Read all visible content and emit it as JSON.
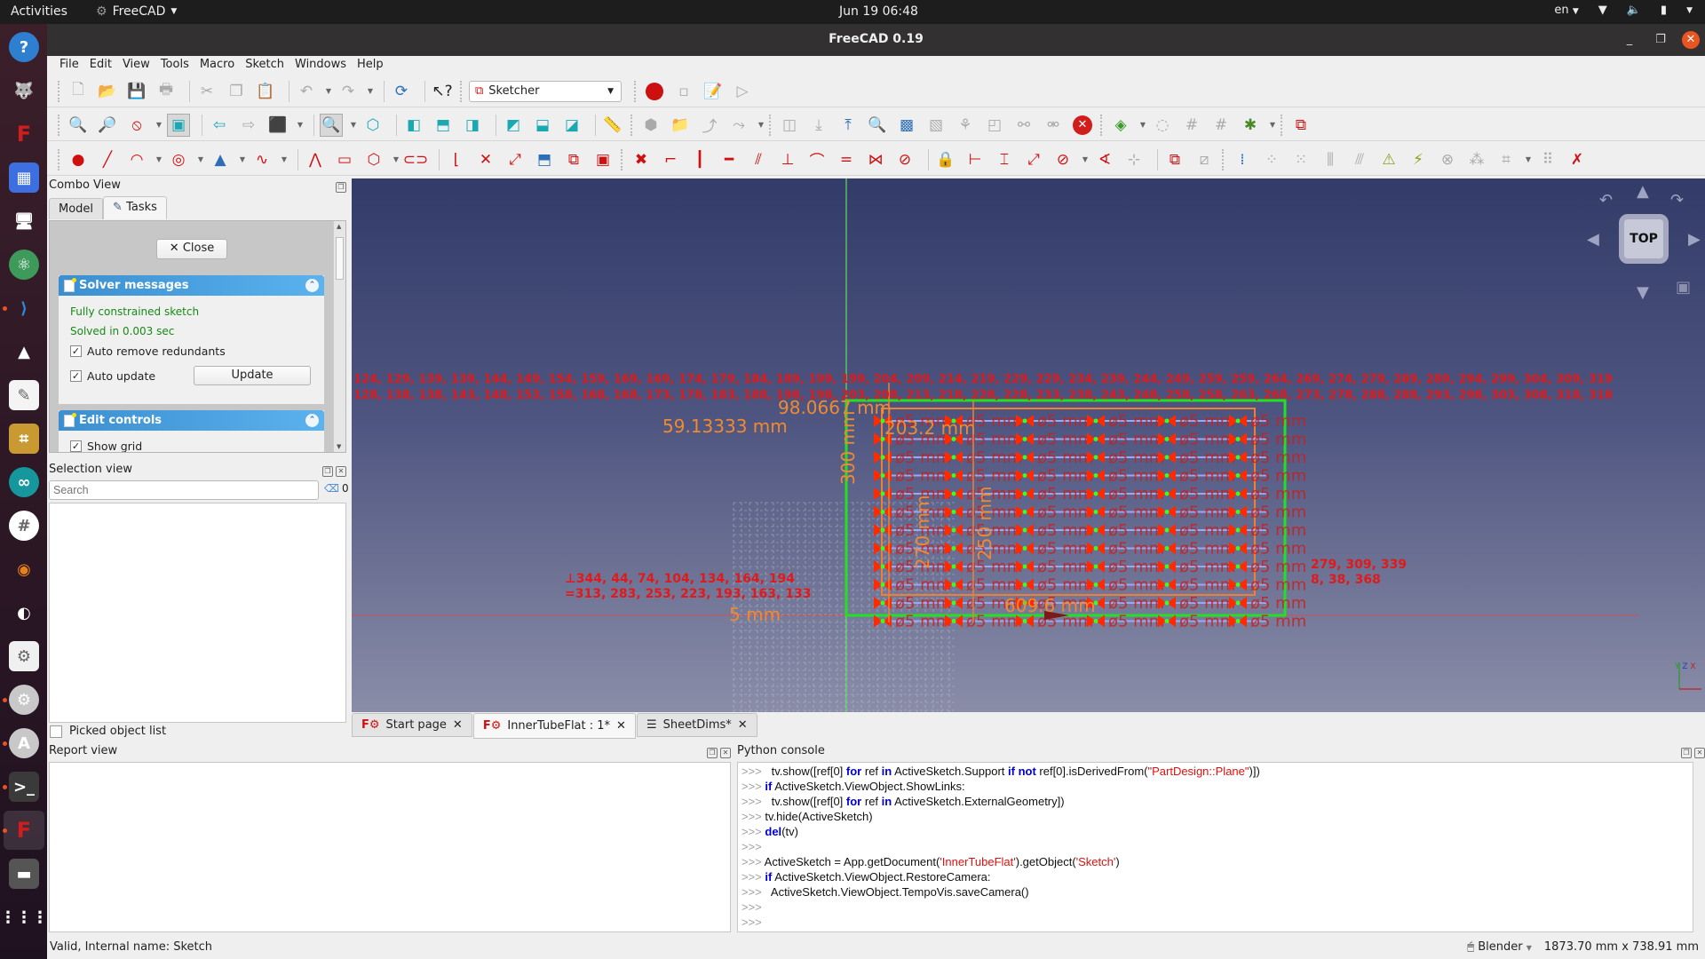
{
  "topbar": {
    "activities": "Activities",
    "app_menu": "FreeCAD",
    "clock": "Jun 19  06:48",
    "language": "en",
    "icons": [
      "wifi-icon",
      "volume-icon",
      "battery-icon",
      "system-menu-icon"
    ]
  },
  "dock": {
    "apps": [
      {
        "name": "help",
        "glyph": "?",
        "bg": "#2f7fd0",
        "running": false
      },
      {
        "name": "gimp",
        "glyph": "🐺",
        "bg": "transparent",
        "running": false
      },
      {
        "name": "freecad",
        "glyph": "F",
        "bg": "transparent",
        "running": false
      },
      {
        "name": "screenshot",
        "glyph": "▦",
        "bg": "#3d6fe0",
        "running": false
      },
      {
        "name": "display-settings",
        "glyph": "🖥",
        "bg": "transparent",
        "running": false
      },
      {
        "name": "atom",
        "glyph": "⚛",
        "bg": "#3d9a5a",
        "running": false
      },
      {
        "name": "vscode",
        "glyph": "⟩",
        "bg": "transparent",
        "running": true
      },
      {
        "name": "inkscape",
        "glyph": "▲",
        "bg": "transparent",
        "running": false
      },
      {
        "name": "text-editor",
        "glyph": "✎",
        "bg": "#f4f4f4",
        "running": false
      },
      {
        "name": "fritzing",
        "glyph": "⌗",
        "bg": "#c99a32",
        "running": false
      },
      {
        "name": "arduino",
        "glyph": "∞",
        "bg": "#16979e",
        "running": false
      },
      {
        "name": "slack",
        "glyph": "#",
        "bg": "#ffffff",
        "running": false
      },
      {
        "name": "blender",
        "glyph": "◉",
        "bg": "transparent",
        "running": false
      },
      {
        "name": "simplescreenrecorder",
        "glyph": "◐",
        "bg": "transparent",
        "running": false
      },
      {
        "name": "settings-alt",
        "glyph": "⚙",
        "bg": "#f0f0f0",
        "running": false
      },
      {
        "name": "system-settings",
        "glyph": "⚙",
        "bg": "#c8c8c8",
        "running": true
      },
      {
        "name": "software-updater",
        "glyph": "A",
        "bg": "#c8c8c8",
        "running": true
      },
      {
        "name": "terminal",
        "glyph": ">_",
        "bg": "#3a3a3a",
        "running": true
      },
      {
        "name": "freecad-active",
        "glyph": "F",
        "bg": "transparent",
        "running": true
      },
      {
        "name": "trash",
        "glyph": "▬",
        "bg": "#555",
        "running": false
      },
      {
        "name": "show-applications",
        "glyph": "⋮⋮⋮",
        "bg": "transparent",
        "running": false
      }
    ]
  },
  "window": {
    "title": "FreeCAD 0.19",
    "minimize": "_",
    "maximize": "❐",
    "close": "✕"
  },
  "menubar": [
    "File",
    "Edit",
    "View",
    "Tools",
    "Macro",
    "Sketch",
    "Windows",
    "Help"
  ],
  "toolbar": {
    "workbench": "Sketcher",
    "file_tools": [
      "new-document-icon",
      "open-icon",
      "save-icon",
      "print-icon",
      "cut-icon",
      "copy-icon",
      "paste-icon",
      "undo-icon",
      "redo-icon",
      "refresh-icon",
      "whats-this-icon"
    ],
    "macro_tools": [
      "record-macro-icon",
      "stop-macro-icon",
      "edit-macro-icon",
      "run-macro-icon"
    ]
  },
  "combo_view": {
    "title": "Combo View",
    "tabs": [
      "Model",
      "Tasks"
    ],
    "active_tab": "Tasks",
    "close_button": "Close",
    "solver_section": {
      "title": "Solver messages",
      "status": "Fully constrained sketch",
      "solve_time": "Solved in 0.003 sec",
      "auto_remove_redundants": {
        "label": "Auto remove redundants",
        "checked": true
      },
      "auto_update": {
        "label": "Auto update",
        "checked": true
      },
      "update_button": "Update"
    },
    "edit_controls": {
      "title": "Edit controls",
      "show_grid": {
        "label": "Show grid",
        "checked": true
      }
    }
  },
  "selection_view": {
    "title": "Selection view",
    "search_placeholder": "Search",
    "count": "0",
    "picked_object_list": {
      "label": "Picked object list",
      "checked": false
    }
  },
  "viewport": {
    "navcube_face": "TOP",
    "constraint_row1": "124, 129, 139, 139, 144, 149, 154, 159, 169, 169, 174, 179, 184, 189, 199, 199, 204, 209, 214, 219, 229, 229, 234, 239, 244, 249, 259, 259, 264, 269, 274, 279, 289, 289, 294, 299, 304, 309, 319",
    "constraint_row2": "128, 138, 138, 143, 148, 153, 158, 168, 168, 173, 178, 183, 188, 198, 198, 203, 208, 213, 218, 228, 228, 233, 238, 243, 248, 258, 258, 263, 268, 273, 278, 288, 288, 293, 298, 303, 308, 318, 318",
    "left_list1": "344, 44, 74, 104, 134, 164, 194",
    "left_list2": "313, 283, 253, 223, 193, 163, 133",
    "right_list1": "279, 309, 339",
    "right_list2": "8, 38, 368",
    "hole_label": "ø5 mm",
    "dim_labels": [
      "203.2 mm",
      "300 mm",
      "270 mm",
      "250 mm",
      "609.6 mm",
      "5 mm",
      "59.13333 mm",
      "98.0667 mm"
    ],
    "axis_labels": {
      "x": "X",
      "y": "Y",
      "z": "Z"
    }
  },
  "doc_tabs": [
    {
      "label": "Start page",
      "icon": "freecad-icon",
      "active": false
    },
    {
      "label": "InnerTubeFlat : 1*",
      "icon": "freecad-icon",
      "active": true
    },
    {
      "label": "SheetDims*",
      "icon": "spreadsheet-icon",
      "active": false
    }
  ],
  "report_view": {
    "title": "Report view"
  },
  "python_console": {
    "title": "Python console",
    "lines": [
      [
        {
          "t": ">>> ",
          "c": "pr"
        },
        {
          "t": "  tv.show([ref[0] ",
          "c": ""
        },
        {
          "t": "for",
          "c": "kw"
        },
        {
          "t": " ref ",
          "c": ""
        },
        {
          "t": "in",
          "c": "kw"
        },
        {
          "t": " ActiveSketch.Support ",
          "c": ""
        },
        {
          "t": "if not",
          "c": "kw"
        },
        {
          "t": " ref[0].isDerivedFrom(",
          "c": ""
        },
        {
          "t": "\"PartDesign::Plane\"",
          "c": "str"
        },
        {
          "t": ")])",
          "c": ""
        }
      ],
      [
        {
          "t": ">>> ",
          "c": "pr"
        },
        {
          "t": "if",
          "c": "kw"
        },
        {
          "t": " ActiveSketch.ViewObject.ShowLinks:",
          "c": ""
        }
      ],
      [
        {
          "t": ">>> ",
          "c": "pr"
        },
        {
          "t": "  tv.show([ref[0] ",
          "c": ""
        },
        {
          "t": "for",
          "c": "kw"
        },
        {
          "t": " ref ",
          "c": ""
        },
        {
          "t": "in",
          "c": "kw"
        },
        {
          "t": " ActiveSketch.ExternalGeometry])",
          "c": ""
        }
      ],
      [
        {
          "t": ">>> ",
          "c": "pr"
        },
        {
          "t": "tv.hide(ActiveSketch)",
          "c": ""
        }
      ],
      [
        {
          "t": ">>> ",
          "c": "pr"
        },
        {
          "t": "del",
          "c": "kw"
        },
        {
          "t": "(tv)",
          "c": ""
        }
      ],
      [
        {
          "t": ">>> ",
          "c": "pr"
        }
      ],
      [
        {
          "t": ">>> ",
          "c": "pr"
        },
        {
          "t": "ActiveSketch = App.getDocument(",
          "c": ""
        },
        {
          "t": "'InnerTubeFlat'",
          "c": "str"
        },
        {
          "t": ").getObject(",
          "c": ""
        },
        {
          "t": "'Sketch'",
          "c": "str"
        },
        {
          "t": ")",
          "c": ""
        }
      ],
      [
        {
          "t": ">>> ",
          "c": "pr"
        },
        {
          "t": "if",
          "c": "kw"
        },
        {
          "t": " ActiveSketch.ViewObject.RestoreCamera:",
          "c": ""
        }
      ],
      [
        {
          "t": ">>> ",
          "c": "pr"
        },
        {
          "t": "  ActiveSketch.ViewObject.TempoVis.saveCamera()",
          "c": ""
        }
      ],
      [
        {
          "t": ">>> ",
          "c": "pr"
        }
      ],
      [
        {
          "t": ">>> ",
          "c": "pr"
        }
      ]
    ]
  },
  "statusbar": {
    "message": "Valid, Internal name: Sketch",
    "nav_style": "Blender",
    "dimensions": "1873.70 mm x 738.91 mm"
  }
}
